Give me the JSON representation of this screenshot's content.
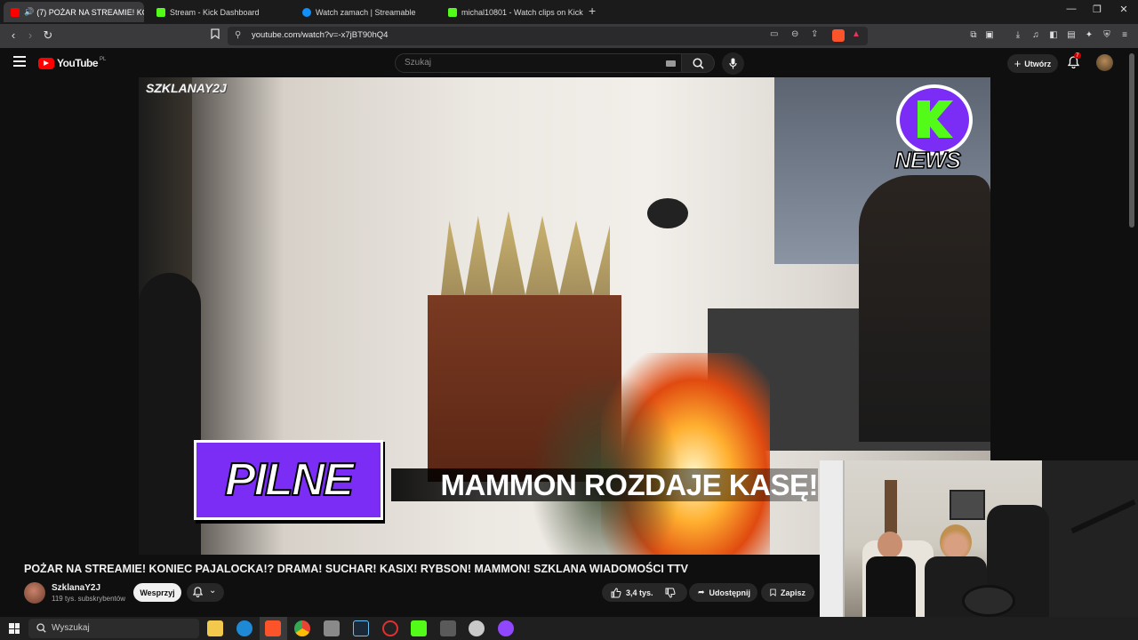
{
  "browser": {
    "tabs": [
      {
        "title": "(7) POŻAR NA STREAMIE! KO",
        "active": true,
        "favicon_color": "#ff0000"
      },
      {
        "title": "Stream - Kick Dashboard",
        "active": false,
        "favicon_color": "#53fc18"
      },
      {
        "title": "Watch zamach | Streamable",
        "active": false,
        "favicon_color": "#0f90fa"
      },
      {
        "title": "michal10801 - Watch clips on Kick",
        "active": false,
        "favicon_color": "#53fc18"
      }
    ],
    "url": "youtube.com/watch?v=-x7jBT90hQ4"
  },
  "youtube": {
    "logo_text": "YouTube",
    "logo_region": "PL",
    "search_placeholder": "Szukaj",
    "create_label": "Utwórz",
    "notification_count": "7",
    "video": {
      "watermark": "SZKLANAY2J",
      "banner_tag": "PILNE",
      "banner_headline": "MAMMON ROZDAJE KASĘ!",
      "badge_text": "NEWS"
    },
    "title": "POŻAR NA STREAMIE! KONIEC PAJALOCKA!? DRAMA! SUCHAR! KASIX! RYBSON! MAMMON! SZKLANA WIADOMOŚCI TTV",
    "channel": {
      "name": "SzklanaY2J",
      "subscribers": "119 tys. subskrybentów",
      "join_label": "Wesprzyj"
    },
    "actions": {
      "likes": "3,4 tys.",
      "share_label": "Udostępnij",
      "save_label": "Zapisz"
    }
  },
  "taskbar": {
    "search_label": "Wyszukaj"
  },
  "colors": {
    "youtube_red": "#ff0000",
    "kick_green": "#53fc18",
    "banner_purple": "#7b2cf5"
  }
}
